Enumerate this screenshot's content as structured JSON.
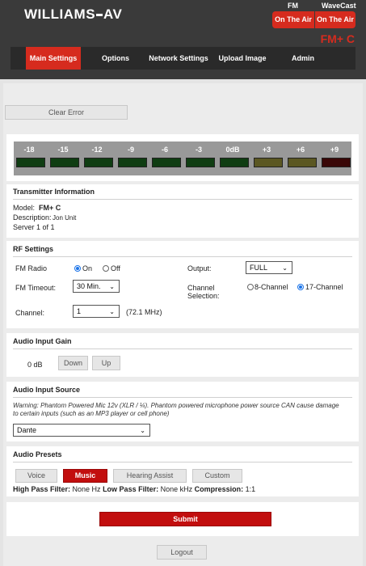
{
  "header": {
    "brand_left": "WILLIAMS",
    "brand_right": "AV",
    "fm_label": "FM",
    "wavecast_label": "WaveCast",
    "fm_status": "On The Air",
    "wavecast_status": "On The Air",
    "model_tag": "FM+ C"
  },
  "nav": {
    "items": [
      "Main Settings",
      "Options",
      "Network Settings",
      "Upload Image",
      "Admin"
    ],
    "active": "Main Settings"
  },
  "clear_error_label": "Clear Error",
  "meter": {
    "labels": [
      "-18",
      "-15",
      "-12",
      "-9",
      "-6",
      "-3",
      "0dB",
      "+3",
      "+6",
      "+9"
    ],
    "colors": [
      "#0f3d12",
      "#0f3d12",
      "#0f3d12",
      "#0f3d12",
      "#0f3d12",
      "#0f3d12",
      "#0f3d12",
      "#5b5722",
      "#5b5722",
      "#3a0707"
    ]
  },
  "transmitter": {
    "title": "Transmitter Information",
    "model_label": "Model:",
    "model_value": "FM+ C",
    "description_label": "Description:",
    "description_value": "Jon Unit",
    "server_text": "Server 1 of 1"
  },
  "rf": {
    "title": "RF Settings",
    "fm_radio_label": "FM Radio",
    "on_label": "On",
    "off_label": "Off",
    "fm_radio_value": "On",
    "fm_timeout_label": "FM Timeout:",
    "fm_timeout_value": "30 Min.",
    "channel_label": "Channel:",
    "channel_value": "1",
    "channel_freq": "(72.1 MHz)",
    "output_label": "Output:",
    "output_value": "FULL",
    "channel_selection_label_1": "Channel",
    "channel_selection_label_2": "Selection:",
    "ch8_label": "8-Channel",
    "ch17_label": "17-Channel",
    "channel_selection_value": "17-Channel"
  },
  "gain": {
    "title": "Audio Input Gain",
    "value": "0 dB",
    "down_label": "Down",
    "up_label": "Up"
  },
  "source": {
    "title": "Audio Input Source",
    "warning_line_1": "Warning: Phantom Powered Mic 12v (XLR / ¼). Phantom powered microphone power source CAN cause damage",
    "warning_line_2": "to certain inputs (such as an MP3 player or cell phone)",
    "value": "Dante"
  },
  "presets": {
    "title": "Audio Presets",
    "buttons": [
      "Voice",
      "Music",
      "Hearing Assist",
      "Custom"
    ],
    "selected": "Music",
    "hp_label": "High Pass Filter:",
    "hp_value": "None Hz",
    "lp_label": "Low Pass Filter:",
    "lp_value": "None kHz",
    "comp_label": "Compression:",
    "comp_value": "1:1"
  },
  "submit_label": "Submit",
  "logout_label": "Logout",
  "colors": {
    "accent": "#d62b1e",
    "header_bg": "#3a3a3a",
    "selected_radio": "#1a73e8"
  }
}
